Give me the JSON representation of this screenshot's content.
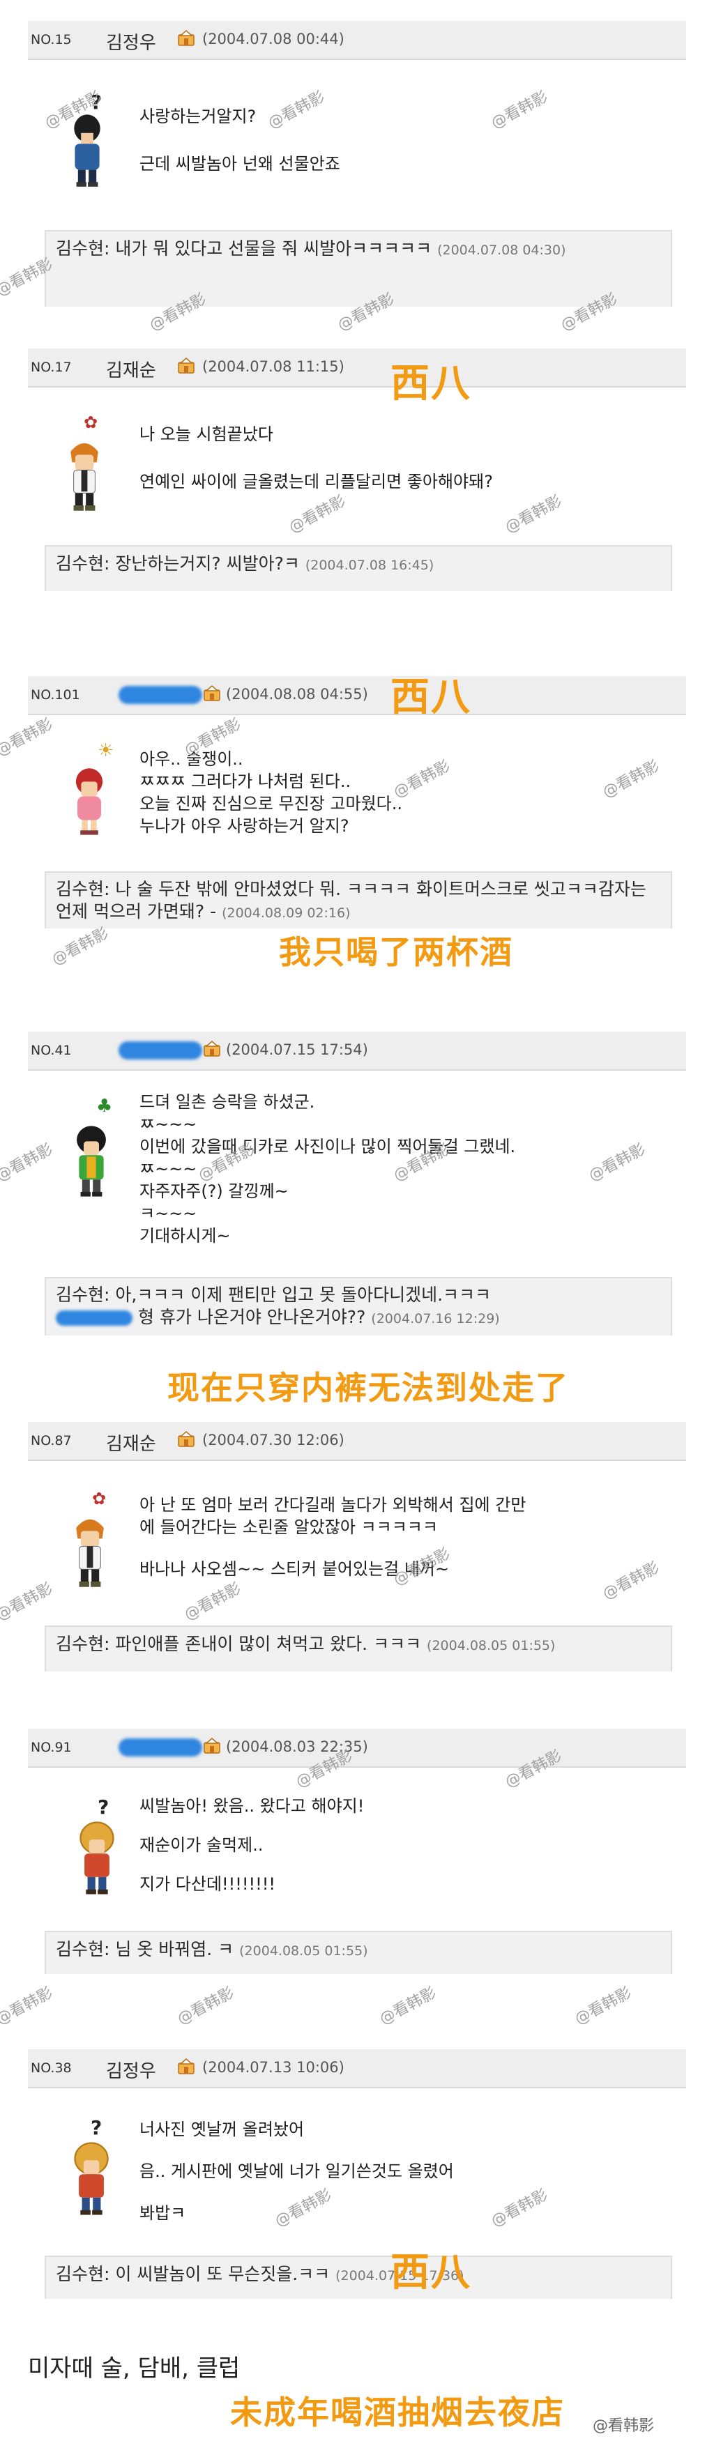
{
  "posts": [
    {
      "no": "NO.15",
      "author": "김정우",
      "date": "(2004.07.08 00:44)",
      "lines": [
        "사랑하는거알지?",
        "근데 씨발놈아 넌왜 선물안죠"
      ],
      "reply_author": "김수현:",
      "reply_text": "내가 뭐 있다고 선물을 줘 씨발아ㅋㅋㅋㅋㅋ",
      "reply_date": "(2004.07.08 04:30)"
    },
    {
      "no": "NO.17",
      "author": "김재순",
      "date": "(2004.07.08 11:15)",
      "lines": [
        "나 오늘 시험끝났다",
        "연예인 싸이에 글올렸는데 리플달리면 좋아해야돼?"
      ],
      "reply_author": "김수현:",
      "reply_text": "장난하는거지? 씨발아?ㅋ",
      "reply_date": "(2004.07.08 16:45)"
    },
    {
      "no": "NO.101",
      "author": "",
      "date": "(2004.08.08 04:55)",
      "lines": [
        "아우.. 술쟁이..",
        "ㅉㅉㅉ 그러다가 나처럼 된다..",
        "오늘 진짜 진심으로 무진장 고마웠다..",
        "누나가 아우 사랑하는거 알지?"
      ],
      "reply_author": "김수현:",
      "reply_text": "나 술 두잔 밖에 안마셨었다 뭐. ㅋㅋㅋㅋ 화이트머스크로 씻고ㅋㅋ감자는 언제 먹으러 가면돼? -",
      "reply_date": "(2004.08.09 02:16)"
    },
    {
      "no": "NO.41",
      "author": "",
      "date": "(2004.07.15 17:54)",
      "lines": [
        "드뎌 일촌 승락을 하셨군.",
        "ㅉ~~~",
        "이번에 갔을때 디카로 사진이나 많이 찍어둘걸 그랬네.",
        "ㅉ~~~",
        "자주자주(?) 갈낑께~",
        "ㅋ~~~",
        "기대하시게~"
      ],
      "reply_author": "김수현:",
      "reply_text": "아,ㅋㅋㅋ 이제 팬티만 입고 못 돌아다니겠네.ㅋㅋㅋ",
      "reply_text2": "형 휴가 나온거야 안나온거야??",
      "reply_date": "(2004.07.16 12:29)"
    },
    {
      "no": "NO.87",
      "author": "김재순",
      "date": "(2004.07.30 12:06)",
      "lines": [
        "아 난 또 엄마 보러 간다길래 놀다가 외박해서 집에 간만",
        "에 들어간다는 소린줄 알았잖아 ㅋㅋㅋㅋㅋ",
        "바나나 사오셈~~ 스티커 붙어있는걸 내꺼~"
      ],
      "reply_author": "김수현:",
      "reply_text": "파인애플 존내이 많이 쳐먹고 왔다. ㅋㅋㅋ",
      "reply_date": "(2004.08.05 01:55)"
    },
    {
      "no": "NO.91",
      "author": "",
      "date": "(2004.08.03 22:35)",
      "lines": [
        "씨발놈아! 왔음.. 왔다고 해야지!",
        "재순이가 술먹제..",
        "지가 다산데!!!!!!!!"
      ],
      "reply_author": "김수현:",
      "reply_text": "님 옷 바꿔염. ㅋ",
      "reply_date": "(2004.08.05 01:55)"
    },
    {
      "no": "NO.38",
      "author": "김정우",
      "date": "(2004.07.13 10:06)",
      "lines": [
        "너사진 옛날꺼 올려놨어",
        "음.. 게시판에 옛날에 너가 일기쓴것도 올렸어",
        "봐밥ㅋ"
      ],
      "reply_author": "김수현:",
      "reply_text": "이 씨발놈이 또 무슨짓을.ㅋㅋ",
      "reply_date": "(2004.07.15 17:36)"
    }
  ],
  "overlays": {
    "xiba1": "西八",
    "xiba2": "西八",
    "two_cups": "我只喝了两杯酒",
    "underwear": "现在只穿内裤无法到处走了",
    "xiba3": "西八",
    "underage": "未成年喝酒抽烟去夜店"
  },
  "watermark": "@看韩影",
  "footer": "미자때 술, 담배, 클럽",
  "weibo": "@看韩影",
  "colors": {
    "overlay": "#f29a12",
    "blur": "#2f86e0",
    "crown": "#e08a1c"
  }
}
